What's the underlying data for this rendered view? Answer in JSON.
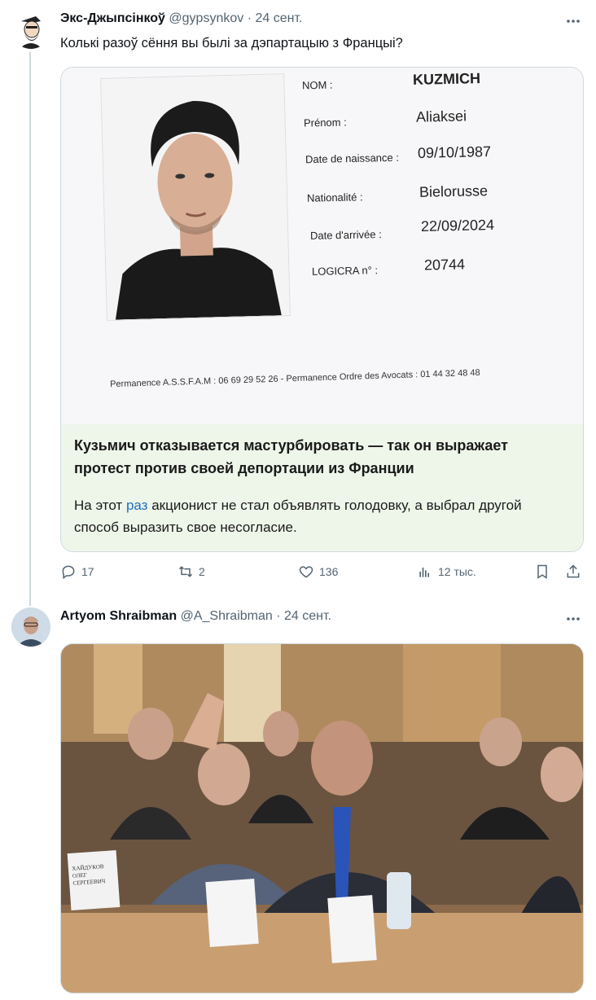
{
  "tweet1": {
    "author_name": "Экс-Джыпсінкоў",
    "author_handle": "@gypsynkov",
    "separator": "·",
    "date": "24 сент.",
    "text": "Колькі разоў сёння вы былі за дэпартацыю з Францыі?",
    "card": {
      "document": {
        "fields": [
          {
            "label": "NOM :",
            "value": "KUZMICH"
          },
          {
            "label": "Prénom :",
            "value": "Aliaksei"
          },
          {
            "label": "Date de naissance :",
            "value": "09/10/1987"
          },
          {
            "label": "Nationalité :",
            "value": "Bielorusse"
          },
          {
            "label": "Date d'arrivée :",
            "value": "22/09/2024"
          },
          {
            "label": "LOGICRA n° :",
            "value": "20744"
          }
        ],
        "permanence": "Permanence A.S.S.F.A.M : 06 69 29 52 26 - Permanence Ordre des Avocats : 01 44 32 48 48"
      },
      "title": "Кузьмич отказывается мастурбировать — так он выражает протест против своей депортации из Франции",
      "desc_before": "На этот ",
      "desc_link": "раз",
      "desc_after": " акционист не стал объявлять голодовку, а выбрал другой способ выразить свое несогласие."
    },
    "actions": {
      "replies": "17",
      "reposts": "2",
      "likes": "136",
      "views": "12 тыс."
    }
  },
  "tweet2": {
    "author_name": "Artyom Shraibman",
    "author_handle": "@A_Shraibman",
    "separator": "·",
    "date": "24 сент.",
    "photo_placard_1": "ХАЙДУКОВ ОЛЕГ СЕРГЕЕВИЧ"
  },
  "colors": {
    "text_primary": "#0f1419",
    "text_secondary": "#536471",
    "border": "#cfd9de",
    "link": "#1d6fc2",
    "card_text_bg": "#eef6ea"
  },
  "icons": [
    "more-icon",
    "reply-icon",
    "repost-icon",
    "like-icon",
    "views-icon",
    "bookmark-icon",
    "share-icon"
  ]
}
